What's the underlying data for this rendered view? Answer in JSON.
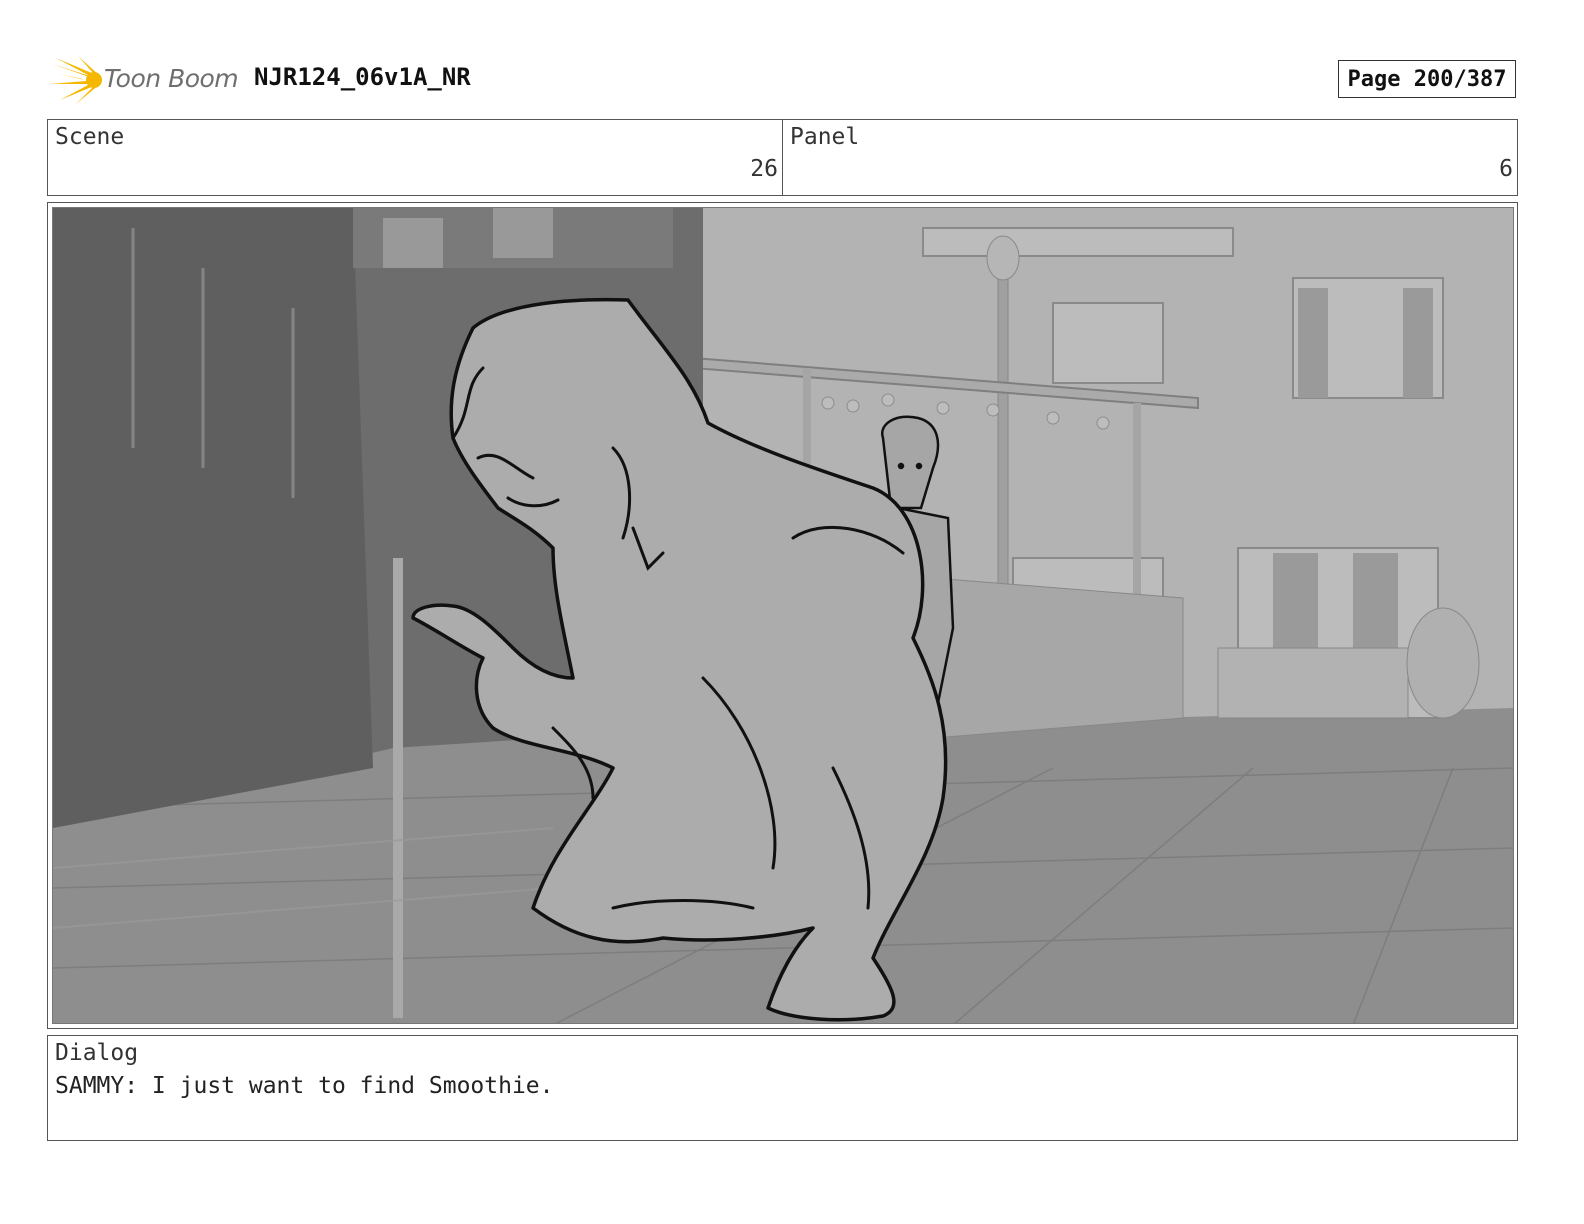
{
  "header": {
    "logo_text": "Toon Boom",
    "project_title": "NJR124_06v1A_NR",
    "page_label": "Page 200/387"
  },
  "info": {
    "scene_label": "Scene",
    "scene_value": "26",
    "panel_label": "Panel",
    "panel_value": "6"
  },
  "dialog": {
    "label": "Dialog",
    "text": "SAMMY: I just want to find Smoothie."
  },
  "colors": {
    "logo_accent": "#F5B800",
    "sketch_fill": "#a8a8a8",
    "background_render": "#9a9a9a"
  }
}
